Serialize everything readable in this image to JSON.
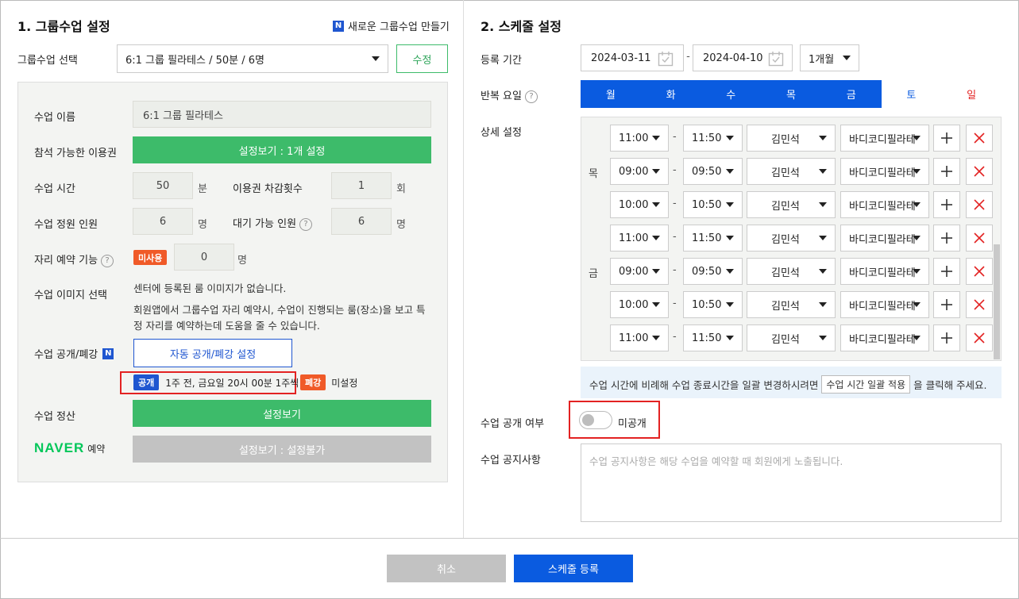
{
  "left": {
    "title": "1. 그룹수업 설정",
    "new_link": "새로운 그룹수업 만들기",
    "n_badge": "N",
    "select_label": "그룹수업 선택",
    "select_value": "6:1 그룹 필라테스 / 50분 / 6명",
    "edit_button": "수정",
    "class_name_label": "수업 이름",
    "class_name_value": "6:1 그룹 필라테스",
    "ticket_label": "참석 가능한 이용권",
    "ticket_button": "설정보기 : 1개 설정",
    "duration_label": "수업 시간",
    "duration_value": "50",
    "duration_unit": "분",
    "deduct_label": "이용권 차감횟수",
    "deduct_value": "1",
    "deduct_unit": "회",
    "capacity_label": "수업 정원 인원",
    "capacity_value": "6",
    "capacity_unit": "명",
    "waiting_label": "대기 가능 인원",
    "waiting_value": "6",
    "waiting_unit": "명",
    "seat_label": "자리 예약 기능",
    "seat_badge": "미사용",
    "seat_value": "0",
    "seat_unit": "명",
    "image_label": "수업 이미지 선택",
    "image_text1": "센터에 등록된 룸 이미지가 없습니다.",
    "image_text2": "회원앱에서 그룹수업 자리 예약시, 수업이 진행되는 룸(장소)을 보고 특",
    "image_text3": "정 자리를 예약하는데 도움을 줄 수 있습니다.",
    "publish_label": "수업 공개/폐강",
    "publish_button": "자동 공개/폐강 설정",
    "open_tag": "공개",
    "open_text": "1주 전, 금요일 20시 00분 1주씩",
    "close_tag": "폐강",
    "close_text": "미설정",
    "settle_label": "수업 정산",
    "settle_button": "설정보기",
    "naver_logo": "NAVER",
    "naver_suffix": "예약",
    "naver_button": "설정보기 : 설정불가",
    "help_glyph": "?"
  },
  "right": {
    "title": "2. 스케줄 설정",
    "period_label": "등록 기간",
    "start_date": "2024-03-11",
    "end_date": "2024-04-10",
    "dash": "-",
    "period_select": "1개월",
    "repeat_label": "반복 요일",
    "days": [
      {
        "label": "월",
        "selected": true
      },
      {
        "label": "화",
        "selected": true
      },
      {
        "label": "수",
        "selected": true
      },
      {
        "label": "목",
        "selected": true
      },
      {
        "label": "금",
        "selected": true
      },
      {
        "label": "토",
        "selected": false
      },
      {
        "label": "일",
        "selected": false
      }
    ],
    "detail_label": "상세 설정",
    "rows": [
      {
        "day": "",
        "start": "11:00",
        "end": "11:50",
        "instructor": "김민석",
        "room": "바디코디필라테"
      },
      {
        "day": "목",
        "start": "09:00",
        "end": "09:50",
        "instructor": "김민석",
        "room": "바디코디필라테"
      },
      {
        "day": "",
        "start": "10:00",
        "end": "10:50",
        "instructor": "김민석",
        "room": "바디코디필라테"
      },
      {
        "day": "",
        "start": "11:00",
        "end": "11:50",
        "instructor": "김민석",
        "room": "바디코디필라테"
      },
      {
        "day": "금",
        "start": "09:00",
        "end": "09:50",
        "instructor": "김민석",
        "room": "바디코디필라테"
      },
      {
        "day": "",
        "start": "10:00",
        "end": "10:50",
        "instructor": "김민석",
        "room": "바디코디필라테"
      },
      {
        "day": "",
        "start": "11:00",
        "end": "11:50",
        "instructor": "김민석",
        "room": "바디코디필라테"
      }
    ],
    "info_text_before": "수업 시간에 비례해 수업 종료시간을 일괄 변경하시려면",
    "info_button": "수업 시간 일괄 적용",
    "info_text_after": "을 클릭해 주세요.",
    "public_label": "수업 공개 여부",
    "public_state": "미공개",
    "notice_label": "수업 공지사항",
    "notice_placeholder": "수업 공지사항은 해당 수업을 예약할 때 회원에게 노출됩니다."
  },
  "footer": {
    "cancel": "취소",
    "submit": "스케줄 등록"
  },
  "colors": {
    "blue": "#0a5be0",
    "green": "#3dbb6a",
    "red": "#e32222",
    "orange": "#f05a28",
    "gray_button": "#c2c2c2"
  }
}
